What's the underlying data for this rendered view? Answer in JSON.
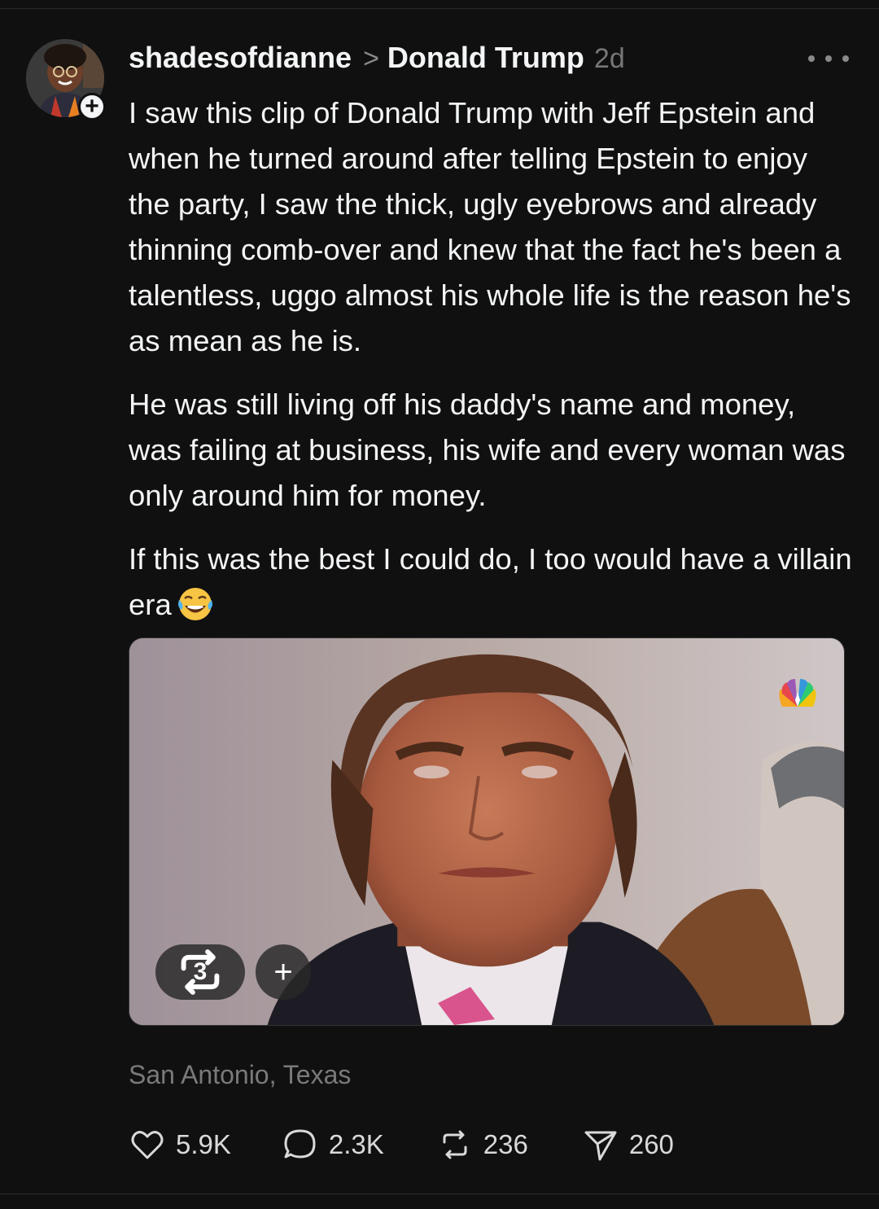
{
  "post": {
    "username": "shadesofdianne",
    "separator": ">",
    "community": "Donald Trump",
    "age": "2d",
    "paragraphs": [
      "I saw this clip of Donald Trump with Jeff Epstein and when he turned around after telling Epstein to enjoy the party, I saw the thick, ugly eyebrows and already thinning comb-over and knew that the fact he's been a talentless, uggo almost his whole life is the reason he's as mean as he is.",
      "He was still living off his daddy's name and money, was failing at business, his wife and every woman was only around him for money.",
      "If this was the best I could do, I too would have a villain era"
    ],
    "emoji": "face-with-tears-of-joy",
    "location": "San Antonio, Texas"
  },
  "media": {
    "repost_count": "3",
    "add_label": "+",
    "watermark": "nbc-peacock-logo"
  },
  "follow_badge": "+",
  "actions": {
    "likes": "5.9K",
    "replies": "2.3K",
    "reposts": "236",
    "shares": "260"
  },
  "colors": {
    "background": "#101010",
    "text": "#f3f5f7",
    "muted": "#7a7a7a"
  }
}
